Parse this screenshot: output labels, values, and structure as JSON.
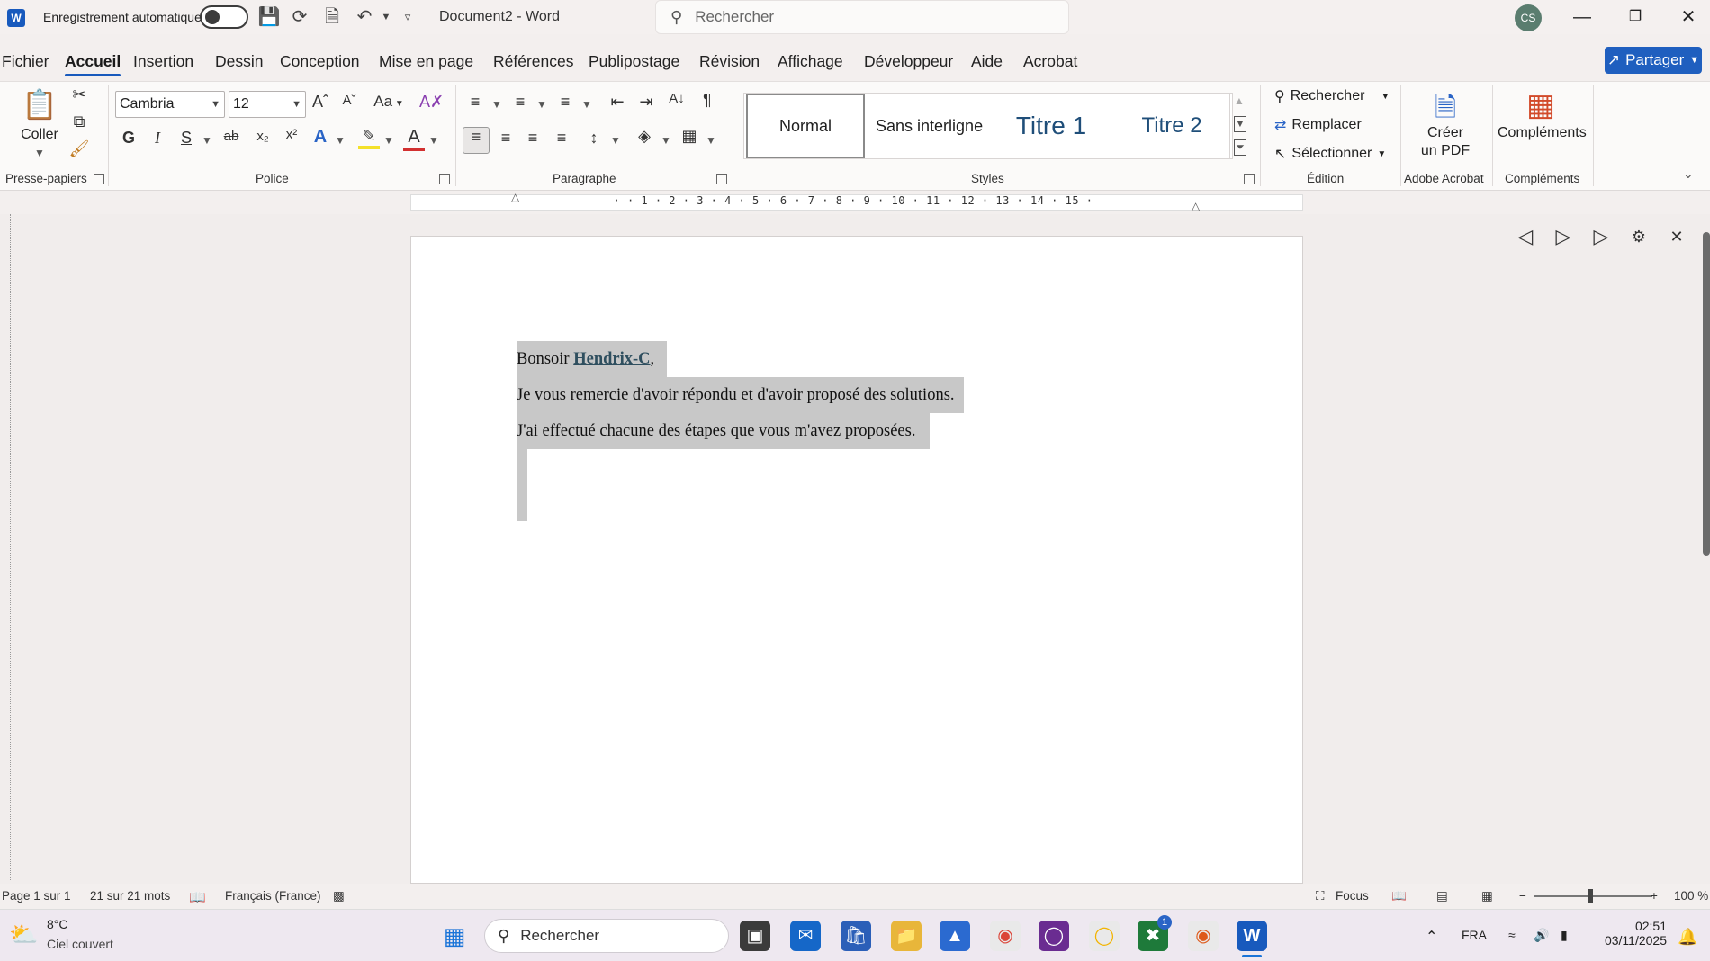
{
  "window": {
    "app_logo": "W",
    "autosave_label": "Enregistrement automatique",
    "doc_title": "Document2 - Word",
    "search_placeholder": "Rechercher",
    "avatar_initials": "CS"
  },
  "tabs": [
    "Fichier",
    "Accueil",
    "Insertion",
    "Dessin",
    "Conception",
    "Mise en page",
    "Références",
    "Publipostage",
    "Révision",
    "Affichage",
    "Développeur",
    "Aide",
    "Acrobat"
  ],
  "active_tab": "Accueil",
  "share_label": "Partager",
  "ribbon": {
    "clipboard": {
      "paste_label": "Coller",
      "group_label": "Presse-papiers"
    },
    "font": {
      "family": "Cambria",
      "size": "12",
      "group_label": "Police",
      "bold": "G",
      "italic": "I",
      "underline": "S",
      "change_case": "Aa"
    },
    "paragraph": {
      "group_label": "Paragraphe"
    },
    "styles": {
      "group_label": "Styles",
      "items": [
        "Normal",
        "Sans interligne",
        "Titre 1",
        "Titre 2"
      ]
    },
    "editing": {
      "group_label": "Édition",
      "find": "Rechercher",
      "replace": "Remplacer",
      "select": "Sélectionner"
    },
    "acrobat": {
      "button_line1": "Créer",
      "button_line2": "un PDF",
      "group_label": "Adobe Acrobat"
    },
    "addins": {
      "button_label": "Compléments",
      "group_label": "Compléments"
    }
  },
  "ruler": {
    "marks": "· · 1 · 2 · 3 · 4 · 5 · 6 · 7 · 8 · 9 · 10 · 11 · 12 · 13 · 14 · 15 ·"
  },
  "document": {
    "greeting_prefix": "Bonsoir ",
    "mention": "Hendrix-C",
    "greeting_suffix": ",",
    "line2": "Je vous remercie d'avoir répondu et d'avoir proposé des solutions.",
    "line3": "J'ai effectué chacune des étapes que vous m'avez proposées."
  },
  "statusbar": {
    "page": "Page 1 sur 1",
    "words": "21 sur 21 mots",
    "language": "Français (France)",
    "focus": "Focus",
    "zoom": "100 %"
  },
  "taskbar": {
    "weather_temp": "8°C",
    "weather_desc": "Ciel couvert",
    "search_label": "Rechercher",
    "language": "FRA",
    "time": "02:51",
    "date": "03/11/2025",
    "badge_count": "1"
  },
  "colors": {
    "accent": "#185abd",
    "share_button": "#1f5fbf",
    "selection": "#c8c8c8"
  }
}
